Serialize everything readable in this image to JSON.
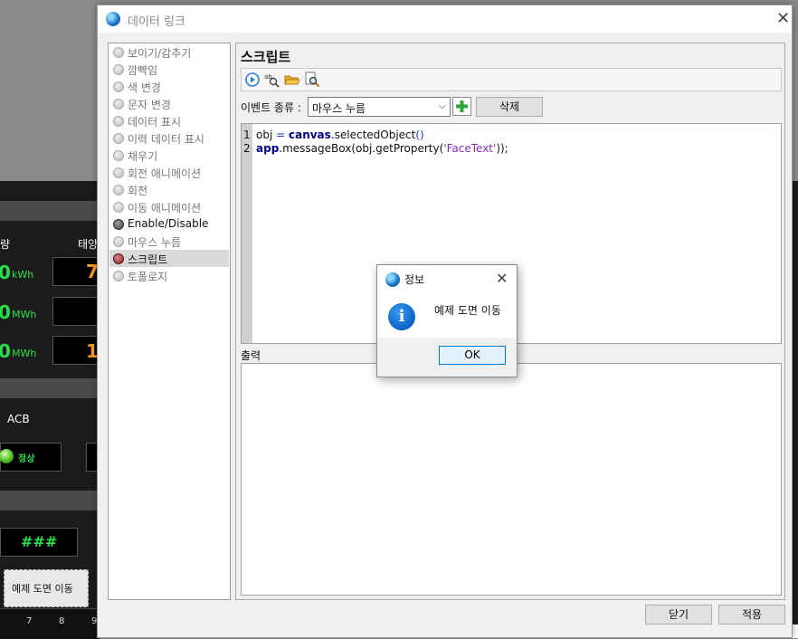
{
  "background_app": {
    "labels": [
      "량",
      "태양",
      "ACB"
    ],
    "readings": [
      {
        "value": "0",
        "unit": "kWh"
      },
      {
        "value": "0",
        "unit": "MWh"
      },
      {
        "value": "0",
        "unit": "MWh"
      }
    ],
    "orange_values": [
      "7",
      "1"
    ],
    "status_label": "정상",
    "hash_display": "###",
    "selected_button_label": "예제 도면 이동",
    "ruler_numbers": [
      "7",
      "8",
      "9"
    ]
  },
  "dialog": {
    "title": "데이터 링크",
    "nav_items": [
      {
        "label": "보이기/감추기",
        "style": "disabled"
      },
      {
        "label": "깜빡임",
        "style": "disabled"
      },
      {
        "label": "색 변경",
        "style": "disabled"
      },
      {
        "label": "문자 변경",
        "style": "disabled"
      },
      {
        "label": "데이터 표시",
        "style": "disabled"
      },
      {
        "label": "이력 데이터 표시",
        "style": "disabled"
      },
      {
        "label": "채우기",
        "style": "disabled"
      },
      {
        "label": "회전 애니메이션",
        "style": "disabled"
      },
      {
        "label": "회전",
        "style": "disabled"
      },
      {
        "label": "이동 애니메이션",
        "style": "disabled"
      },
      {
        "label": "Enable/Disable",
        "style": "enabled"
      },
      {
        "label": "마우스 누름",
        "style": "disabled"
      },
      {
        "label": "스크립트",
        "style": "selected"
      },
      {
        "label": "토폴로지",
        "style": "disabled"
      }
    ],
    "script": {
      "section_title": "스크립트",
      "toolbar_icons": [
        "run-icon",
        "search-replace-icon",
        "open-folder-icon",
        "find-icon"
      ],
      "event_label": "이벤트 종류 :",
      "event_value": "마우스 누름",
      "delete_label": "삭제",
      "code_lines": [
        {
          "num": "1",
          "parts": [
            [
              "fn",
              "obj "
            ],
            [
              "op",
              "= "
            ],
            [
              "kw",
              "canvas"
            ],
            [
              "fn",
              ".selectedObject"
            ],
            [
              "op",
              "()"
            ]
          ]
        },
        {
          "num": "2",
          "parts": [
            [
              "kw",
              "app"
            ],
            [
              "fn",
              ".messageBox(obj.getProperty("
            ],
            [
              "str",
              "'FaceText'"
            ],
            [
              "fn",
              "));"
            ]
          ]
        }
      ],
      "output_label": "출력"
    },
    "footer": {
      "close_label": "닫기",
      "apply_label": "적용"
    }
  },
  "message_box": {
    "title": "정보",
    "message": "예제 도면 이동",
    "ok_label": "OK",
    "icon": "info-icon"
  },
  "colors": {
    "accent": "#0078d7",
    "reading_green": "#26e04a",
    "reading_orange": "#ff9a1e",
    "selection_gray": "#d9d9d9"
  }
}
